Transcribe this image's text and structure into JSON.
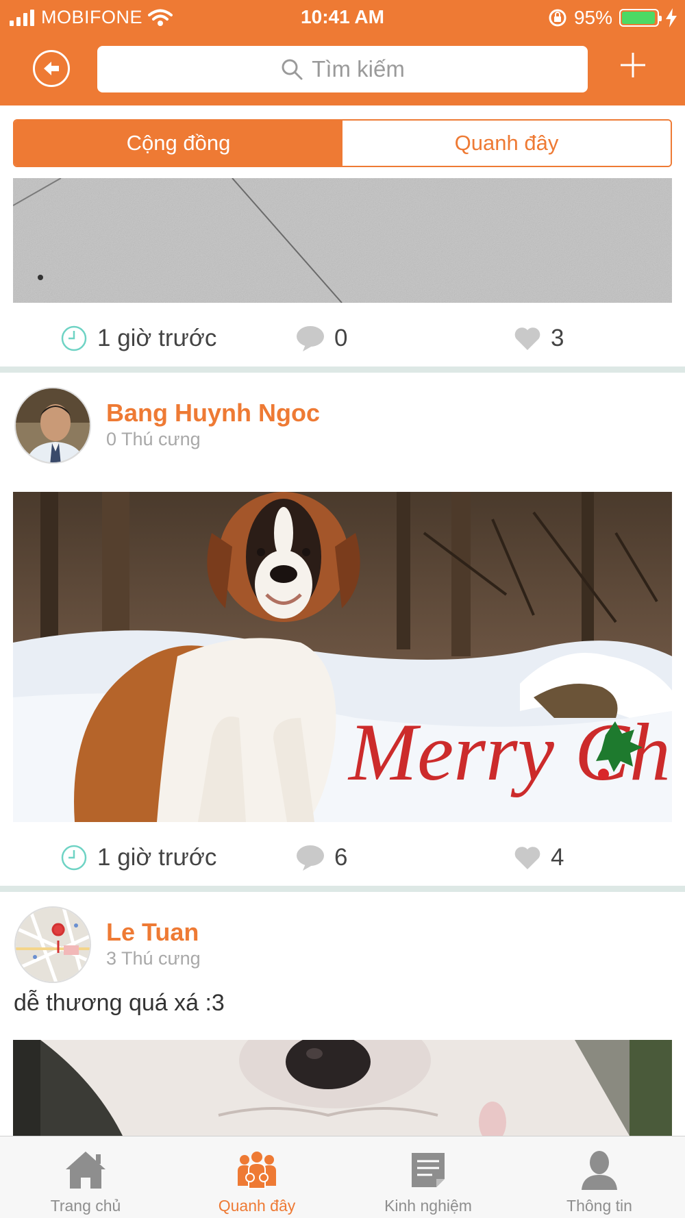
{
  "status_bar": {
    "carrier": "MOBIFONE",
    "time": "10:41 AM",
    "battery": "95%",
    "battery_level": 0.95,
    "battery_color": "#4cd964"
  },
  "header": {
    "back_icon": "back-arrow-icon",
    "search_placeholder": "Tìm kiếm",
    "add_icon": "plus-icon",
    "color": "#ee7a34"
  },
  "segment": {
    "tabs": [
      {
        "label": "Cộng đồng",
        "active": true
      },
      {
        "label": "Quanh đây",
        "active": false
      }
    ]
  },
  "posts": [
    {
      "image": "pavement-photo",
      "time": "1 giờ trước",
      "comments": "0",
      "likes": "3"
    },
    {
      "author": "Bang Huynh Ngoc",
      "pets": "0 Thú cưng",
      "image": "saint-bernard-christmas-photo",
      "image_text": "Merry Christmas",
      "time": "1 giờ trước",
      "comments": "6",
      "likes": "4"
    },
    {
      "author": "Le Tuan",
      "pets": "3 Thú cưng",
      "caption": "dễ thương quá xá :3",
      "image": "puppy-closeup-photo"
    }
  ],
  "tabbar": {
    "items": [
      {
        "label": "Trang chủ",
        "icon": "home-icon",
        "active": false
      },
      {
        "label": "Quanh đây",
        "icon": "people-icon",
        "active": true
      },
      {
        "label": "Kinh nghiệm",
        "icon": "document-icon",
        "active": false
      },
      {
        "label": "Thông tin",
        "icon": "user-icon",
        "active": false
      }
    ],
    "accent": "#ee7a34"
  }
}
